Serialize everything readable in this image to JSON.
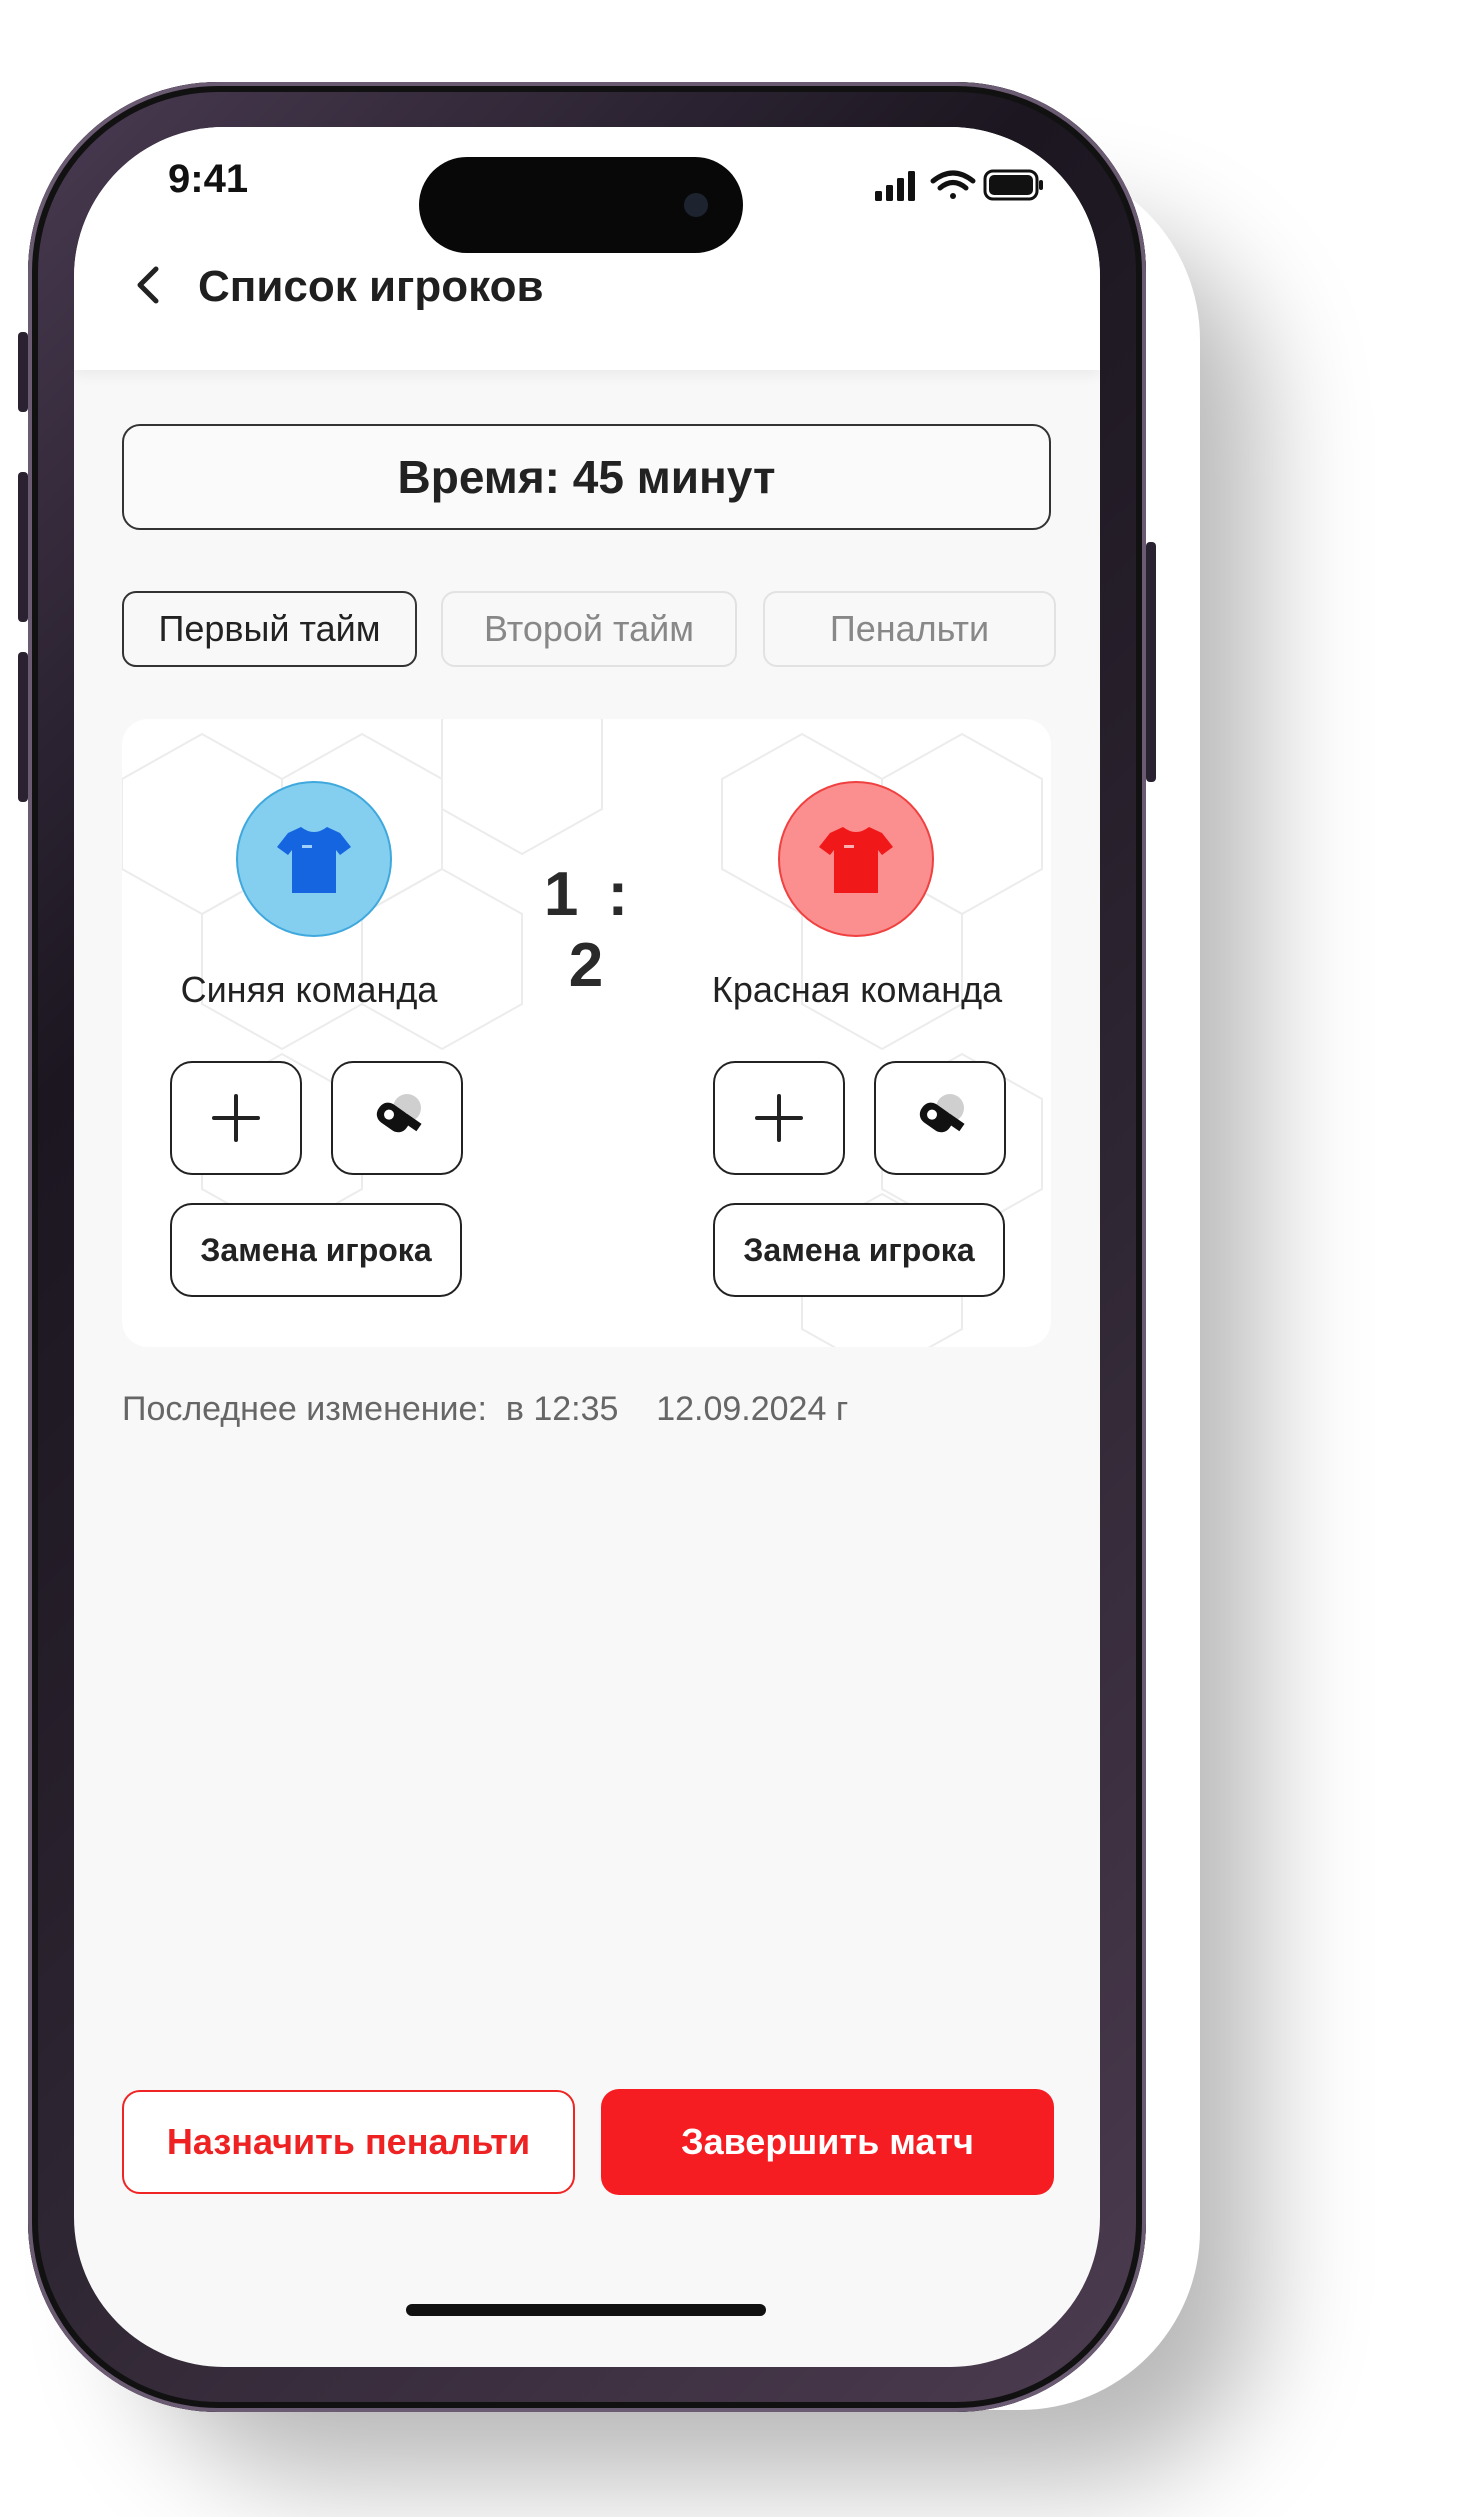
{
  "status_bar": {
    "time": "9:41"
  },
  "header": {
    "title": "Список игроков"
  },
  "timer": {
    "label": "Время: 45 минут"
  },
  "tabs": [
    {
      "label": "Первый тайм",
      "active": true
    },
    {
      "label": "Второй тайм",
      "active": false
    },
    {
      "label": "Пенальти",
      "active": false
    }
  ],
  "match": {
    "score": "1 : 2",
    "home": {
      "name": "Синяя команда",
      "jersey_color": "#1565e0",
      "circle_color": "#84cff0",
      "substitution_label": "Замена игрока"
    },
    "away": {
      "name": "Красная команда",
      "jersey_color": "#f01818",
      "circle_color": "#fb8e8e",
      "substitution_label": "Замена игрока"
    }
  },
  "footer_info": {
    "label": "Последнее изменение:",
    "time": "в 12:35",
    "date": "12.09.2024 г"
  },
  "actions": {
    "penalty_label": "Назначить пенальти",
    "finish_label": "Завершить матч"
  },
  "colors": {
    "accent": "#f51d22"
  }
}
